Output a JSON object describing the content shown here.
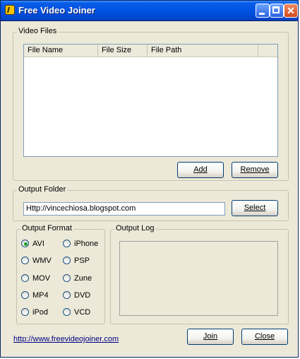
{
  "window": {
    "title": "Free Video Joiner"
  },
  "titlebar_buttons": {
    "minimize": "minimize",
    "maximize": "maximize",
    "close": "✕"
  },
  "video_files": {
    "group_label": "Video Files",
    "columns": [
      "File Name",
      "File Size",
      "File Path"
    ],
    "rows": [],
    "add_label": "Add",
    "remove_label": "Remove"
  },
  "output_folder": {
    "group_label": "Output Folder",
    "value": "Http://vincechiosa.blogspot.com",
    "select_label": "Select"
  },
  "output_format": {
    "group_label": "Output Format",
    "selected": "AVI",
    "options": [
      "AVI",
      "iPhone",
      "WMV",
      "PSP",
      "MOV",
      "Zune",
      "MP4",
      "DVD",
      "iPod",
      "VCD"
    ]
  },
  "output_log": {
    "group_label": "Output Log"
  },
  "footer": {
    "link": "http://www.freevideojoiner.com",
    "join_label": "Join",
    "close_label": "Close"
  },
  "colors": {
    "title_bar": "#0054e3",
    "window_bg": "#ece9d8",
    "link": "#000080",
    "radio_dot": "#21a121"
  }
}
